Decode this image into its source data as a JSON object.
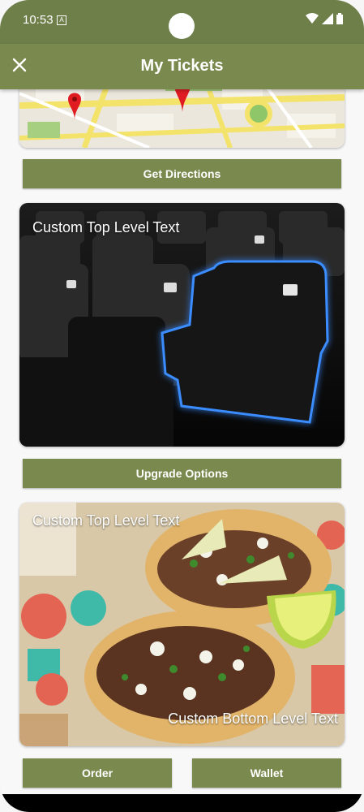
{
  "status_bar": {
    "time": "10:53",
    "notification_icon": "a-icon"
  },
  "app_bar": {
    "title": "My Tickets",
    "close_icon": "close-icon"
  },
  "map_card": {
    "image": "street-map-with-pins"
  },
  "directions_button": {
    "label": "Get Directions"
  },
  "seat_card": {
    "top_text": "Custom Top Level Text",
    "image": "stadium-seat-highlighted"
  },
  "upgrade_button": {
    "label": "Upgrade Options"
  },
  "food_card": {
    "top_text": "Custom Top Level Text",
    "bottom_text": "Custom Bottom Level Text",
    "image": "tacos"
  },
  "order_button": {
    "label": "Order"
  },
  "wallet_button": {
    "label": "Wallet"
  },
  "colors": {
    "primary": "#7a8a4e",
    "status": "#6e7f4a"
  }
}
